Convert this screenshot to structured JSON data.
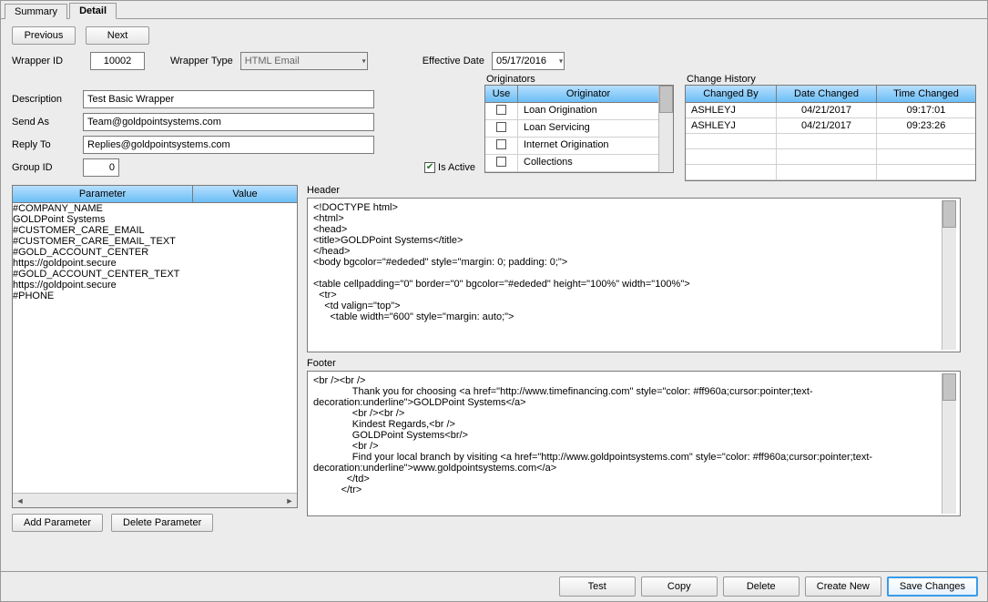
{
  "tabs": {
    "summary": "Summary",
    "detail": "Detail"
  },
  "nav": {
    "previous": "Previous",
    "next": "Next"
  },
  "labels": {
    "wrapperId": "Wrapper ID",
    "wrapperType": "Wrapper Type",
    "effectiveDate": "Effective Date",
    "originators": "Originators",
    "changeHistory": "Change History",
    "description": "Description",
    "sendAs": "Send As",
    "replyTo": "Reply To",
    "groupId": "Group ID",
    "isActive": "Is Active",
    "header": "Header",
    "footer": "Footer"
  },
  "fields": {
    "wrapperId": "10002",
    "wrapperType": "HTML Email",
    "effectiveDate": "05/17/2016",
    "description": "Test Basic Wrapper",
    "sendAs": "Team@goldpointsystems.com",
    "replyTo": "Replies@goldpointsystems.com",
    "groupId": "0",
    "isActive": true
  },
  "originatorsGrid": {
    "headers": {
      "use": "Use",
      "originator": "Originator"
    },
    "rows": [
      {
        "use": false,
        "name": "Loan Origination"
      },
      {
        "use": false,
        "name": "Loan Servicing"
      },
      {
        "use": false,
        "name": "Internet Origination"
      },
      {
        "use": false,
        "name": "Collections"
      }
    ]
  },
  "changeHistoryGrid": {
    "headers": {
      "changedBy": "Changed By",
      "dateChanged": "Date Changed",
      "timeChanged": "Time Changed"
    },
    "rows": [
      {
        "changedBy": "ASHLEYJ",
        "dateChanged": "04/21/2017",
        "timeChanged": "09:17:01"
      },
      {
        "changedBy": "ASHLEYJ",
        "dateChanged": "04/21/2017",
        "timeChanged": "09:23:26"
      }
    ]
  },
  "paramGrid": {
    "headers": {
      "parameter": "Parameter",
      "value": "Value"
    },
    "rows": [
      {
        "parameter": "#COMPANY_NAME",
        "value": "GOLDPoint Systems"
      },
      {
        "parameter": "#CUSTOMER_CARE_EMAIL",
        "value": ""
      },
      {
        "parameter": "#CUSTOMER_CARE_EMAIL_TEXT",
        "value": ""
      },
      {
        "parameter": "#GOLD_ACCOUNT_CENTER",
        "value": "https://goldpoint.secure"
      },
      {
        "parameter": "#GOLD_ACCOUNT_CENTER_TEXT",
        "value": "https://goldpoint.secure"
      },
      {
        "parameter": "#PHONE",
        "value": ""
      }
    ]
  },
  "headerText": "<!DOCTYPE html>\n<html>\n<head>\n<title>GOLDPoint Systems</title>\n</head>\n<body bgcolor=\"#ededed\" style=\"margin: 0; padding: 0;\">\n\n<table cellpadding=\"0\" border=\"0\" bgcolor=\"#ededed\" height=\"100%\" width=\"100%\">\n  <tr>\n    <td valign=\"top\">\n      <table width=\"600\" style=\"margin: auto;\">",
  "footerText": "<br /><br />\n              Thank you for choosing <a href=\"http://www.timefinancing.com\" style=\"color: #ff960a;cursor:pointer;text-decoration:underline\">GOLDPoint Systems</a>\n              <br /><br />\n              Kindest Regards,<br />\n              GOLDPoint Systems<br/>\n              <br />\n              Find your local branch by visiting <a href=\"http://www.goldpointsystems.com\" style=\"color: #ff960a;cursor:pointer;text-decoration:underline\">www.goldpointsystems.com</a>\n            </td>\n          </tr>",
  "paramButtons": {
    "add": "Add Parameter",
    "delete": "Delete Parameter"
  },
  "bottomButtons": {
    "test": "Test",
    "copy": "Copy",
    "delete": "Delete",
    "createNew": "Create New",
    "saveChanges": "Save Changes"
  }
}
